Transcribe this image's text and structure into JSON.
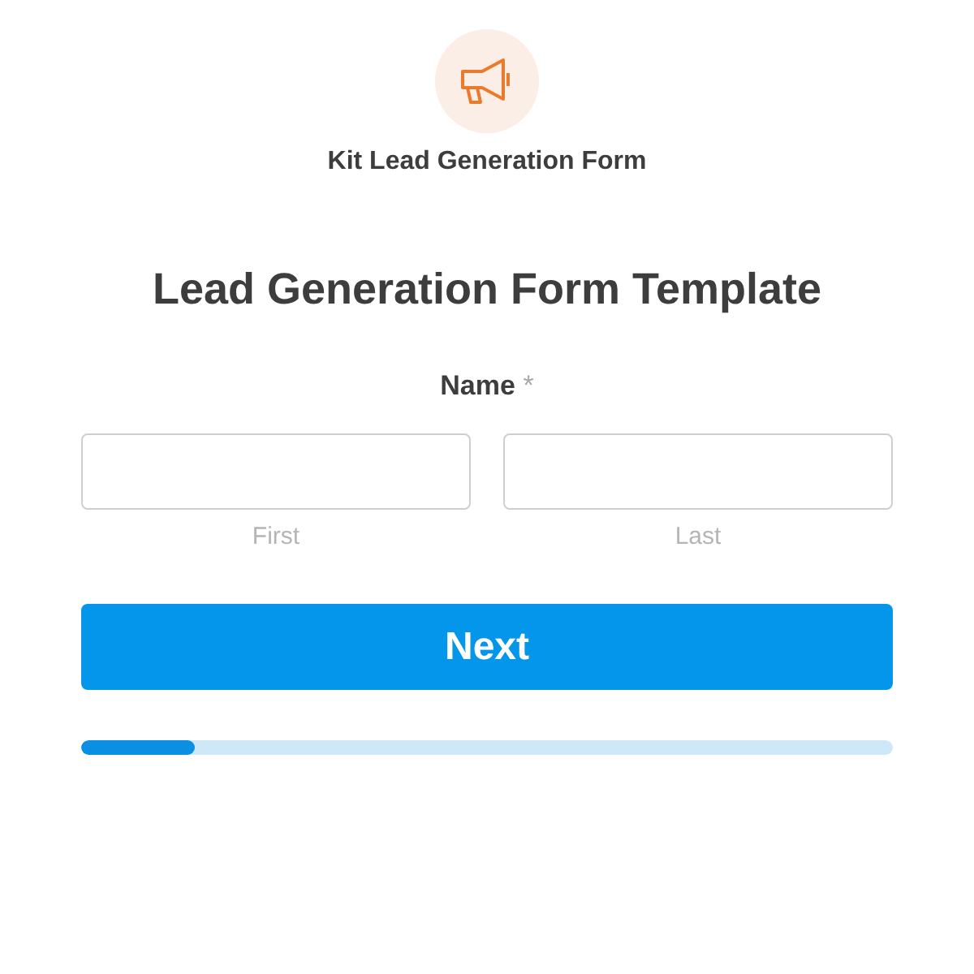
{
  "header": {
    "title": "Kit Lead Generation Form"
  },
  "form": {
    "heading": "Lead Generation Form Template",
    "field": {
      "label": "Name",
      "required_mark": "*",
      "inputs": [
        {
          "sublabel": "First"
        },
        {
          "sublabel": "Last"
        }
      ]
    },
    "button": "Next",
    "progress": {
      "level": 0.14
    }
  }
}
